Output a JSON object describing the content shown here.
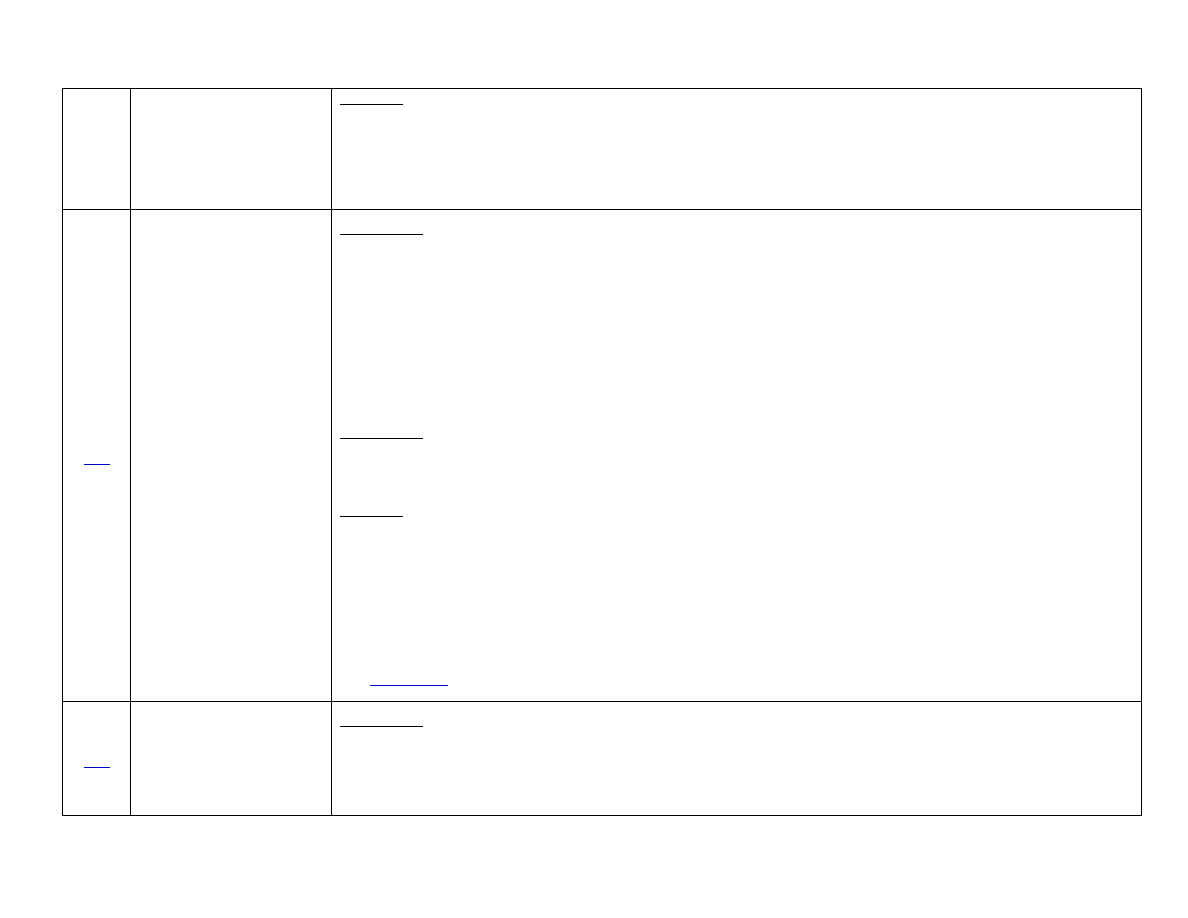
{
  "table": {
    "rows": [
      {
        "number_link": "",
        "label": "",
        "content": ""
      },
      {
        "number_link": "",
        "label": "",
        "content": "",
        "footer_link": ""
      },
      {
        "number_link": "",
        "label": "",
        "content": ""
      }
    ]
  },
  "colors": {
    "border": "#000000",
    "link": "#0000cc",
    "background": "#ffffff"
  }
}
